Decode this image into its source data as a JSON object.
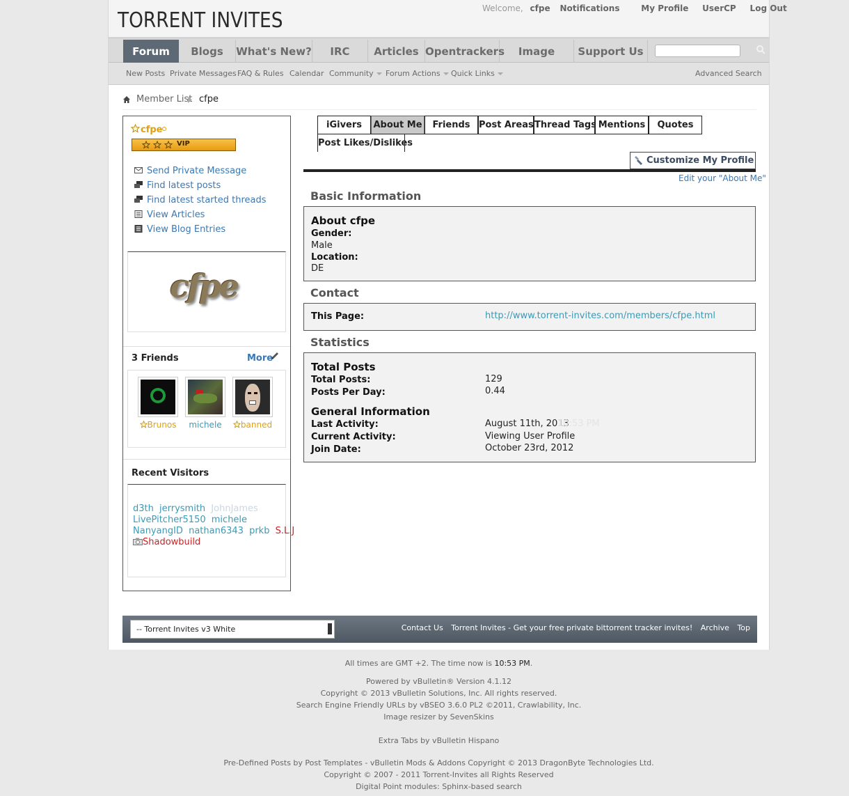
{
  "header": {
    "logo": "TORRENT INVITES",
    "welcome": "Welcome,",
    "username": "cfpe",
    "links": [
      "Notifications",
      "My Profile",
      "UserCP",
      "Log Out"
    ]
  },
  "navbar": {
    "tabs": [
      "Forum",
      "Blogs",
      "What's New?",
      "IRC",
      "Articles",
      "Opentrackers",
      "Image Dump",
      "Support Us"
    ],
    "search_value": ""
  },
  "subnav": {
    "links": [
      "New Posts",
      "Private Messages",
      "FAQ & Rules",
      "Calendar",
      "Community",
      "Forum Actions",
      "Quick Links"
    ],
    "advanced_search": "Advanced Search"
  },
  "breadcrumb": {
    "parent": "Member List",
    "current": "cfpe"
  },
  "sidebar": {
    "username": "cfpe",
    "rank_text": "VIP",
    "actions": [
      "Send Private Message",
      "Find latest posts",
      "Find latest started threads",
      "View Articles",
      "View Blog Entries"
    ],
    "avatar_text": "cfpe",
    "friends_title": "3 Friends",
    "friends_more": "More",
    "friends": [
      "Brunos",
      "michele",
      "banned"
    ],
    "visitors_title": "Recent Visitors",
    "visitors_line1": [
      "d3th",
      "jerrysmith",
      "JohnJames"
    ],
    "visitors_line2": [
      "LivePitcher5150",
      "michele"
    ],
    "visitors_line3": [
      "NanyangID",
      "nathan6343",
      "prkb",
      "S.L.J"
    ],
    "visitors_line4": [
      "Shadowbuild"
    ]
  },
  "tabs": {
    "row1": [
      "iGivers",
      "About Me",
      "Friends",
      "Post Areas",
      "Thread Tags",
      "Mentions",
      "Quotes"
    ],
    "row2": [
      "Post Likes/Dislikes"
    ],
    "customize": "Customize My Profile",
    "edit_link": "Edit your \"About Me\""
  },
  "basic": {
    "heading": "Basic Information",
    "about_title": "About cfpe",
    "gender_label": "Gender:",
    "gender": "Male",
    "location_label": "Location:",
    "location": "DE"
  },
  "contact": {
    "heading": "Contact",
    "page_label": "This Page:",
    "page_url": "http://www.torrent-invites.com/members/cfpe.html"
  },
  "stats": {
    "heading": "Statistics",
    "total_posts_title": "Total Posts",
    "total_posts_label": "Total Posts:",
    "total_posts": "129",
    "ppd_label": "Posts Per Day:",
    "ppd": "0.44",
    "general_title": "General Information",
    "last_activity_label": "Last Activity:",
    "last_activity": "August 11th, 2013",
    "last_activity_time": "10:53 PM",
    "current_activity_label": "Current Activity:",
    "current_activity": "Viewing User Profile",
    "join_label": "Join Date:",
    "join_date": "October 23rd, 2012"
  },
  "footer": {
    "style_select": "-- Torrent Invites v3 White",
    "links": [
      "Contact Us",
      "Torrent Invites - Get your free private bittorrent tracker invites!",
      "Archive",
      "Top"
    ],
    "timezone": "All times are GMT +2. The time now is",
    "time_now": "10:53 PM",
    "lines": [
      "Powered by vBulletin® Version 4.1.12",
      "Copyright © 2013 vBulletin Solutions, Inc. All rights reserved.",
      "Search Engine Friendly URLs by vBSEO 3.6.0 PL2 ©2011, Crawlability, Inc.",
      "Image resizer by SevenSkins",
      "Extra Tabs by vBulletin Hispano",
      "Pre-Defined Posts by Post Templates - vBulletin Mods & Addons Copyright © 2013 DragonByte Technologies Ltd.",
      "Copyright © 2007 - 2011 Torrent-Invites all Rights Reserved",
      "Digital Point modules: Sphinx-based search"
    ]
  },
  "colors": {
    "link": "#3a78b5",
    "nav_active": "#5d6975",
    "vip_name": "#e0a010",
    "red_user": "#cc2222"
  },
  "icons": [
    "home-icon",
    "arrow-icon",
    "envelope-icon",
    "posts-icon",
    "article-icon",
    "blog-icon",
    "pencil-icon",
    "star-icon",
    "search-icon",
    "brush-icon",
    "camera-icon"
  ]
}
